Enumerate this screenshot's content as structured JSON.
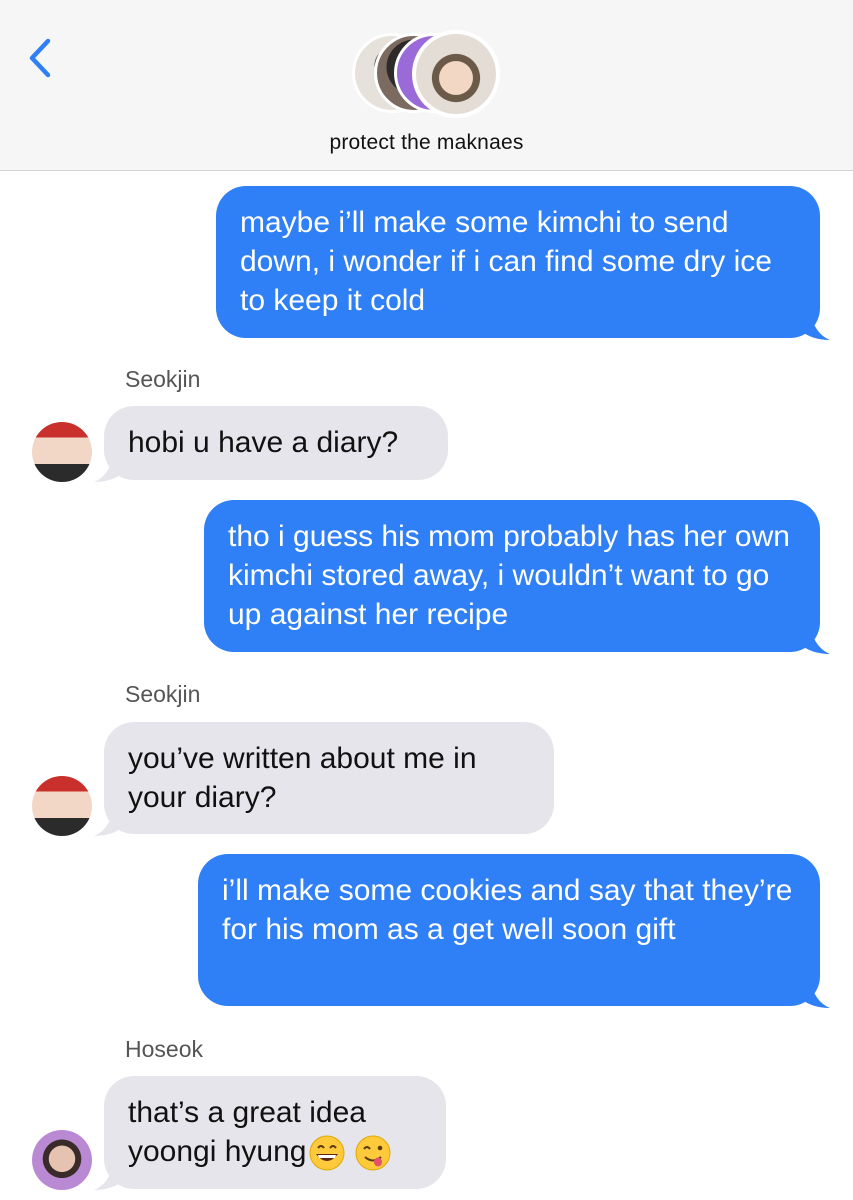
{
  "header": {
    "back_icon": "chevron-left-icon",
    "group_name": "protect the maknaes",
    "accent_color": "#2f7ff6"
  },
  "messages": [
    {
      "direction": "outgoing",
      "text": "maybe i’ll make some kimchi to send down, i wonder if i can find some dry ice to keep it cold"
    },
    {
      "direction": "incoming",
      "sender": "Seokjin",
      "text": "hobi u have a diary?"
    },
    {
      "direction": "outgoing",
      "text": "tho i guess his mom probably has her own kimchi stored away, i wouldn’t want to go up against her recipe"
    },
    {
      "direction": "incoming",
      "sender": "Seokjin",
      "text": "you’ve written about me in your diary?"
    },
    {
      "direction": "outgoing",
      "text": "i’ll make some cookies and say that they’re for his mom as a get well soon gift"
    },
    {
      "direction": "incoming",
      "sender": "Hoseok",
      "text": "that’s a great idea yoongi hyung",
      "emojis": [
        "grinning-face-emoji",
        "face-savoring-food-emoji"
      ]
    }
  ],
  "colors": {
    "outgoing_bubble": "#2f7ff6",
    "incoming_bubble": "#e6e5eb",
    "header_bg": "#f6f6f6"
  }
}
